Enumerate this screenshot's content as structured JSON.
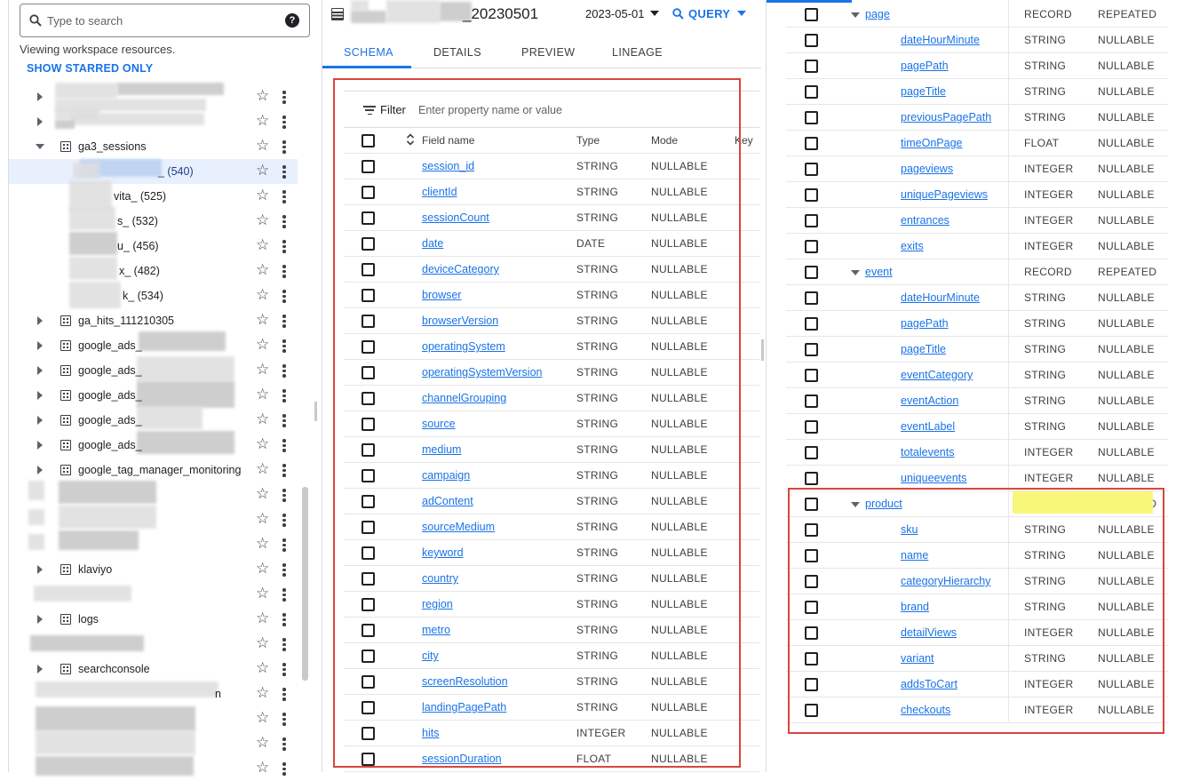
{
  "explorer": {
    "search": {
      "placeholder": "Type to search",
      "help_icon": "?"
    },
    "viewing_text": "Viewing workspace resources.",
    "show_starred_label": "SHOW STARRED ONLY",
    "items": [
      {
        "label": "ga3_sessions"
      },
      {
        "label": "_ (540)"
      },
      {
        "label": "vita_ (525)"
      },
      {
        "label": "s_ (532)"
      },
      {
        "label": "u_ (456)"
      },
      {
        "label": "x_ (482)"
      },
      {
        "label": "k_ (534)"
      },
      {
        "label": "ga_hits_111210305"
      },
      {
        "label": "google_ads_"
      },
      {
        "label": "google_ads_"
      },
      {
        "label": "google_ads_"
      },
      {
        "label": "google_ads_"
      },
      {
        "label": "google_ads_"
      },
      {
        "label": "google_tag_manager_monitoring"
      },
      {
        "label": "klaviyo"
      },
      {
        "label": "logs"
      },
      {
        "label": "searchconsole"
      },
      {
        "label": "n"
      }
    ]
  },
  "header": {
    "table_title": "_20230501",
    "date_value": "2023-05-01",
    "query_label": "QUERY"
  },
  "tabs": [
    "SCHEMA",
    "DETAILS",
    "PREVIEW",
    "LINEAGE"
  ],
  "filter": {
    "label": "Filter",
    "placeholder": "Enter property name or value"
  },
  "schema_header": {
    "field_name": "Field name",
    "type": "Type",
    "mode": "Mode",
    "key": "Key"
  },
  "schema_fields": [
    {
      "name": "session_id",
      "type": "STRING",
      "mode": "NULLABLE"
    },
    {
      "name": "clientId",
      "type": "STRING",
      "mode": "NULLABLE"
    },
    {
      "name": "sessionCount",
      "type": "STRING",
      "mode": "NULLABLE"
    },
    {
      "name": "date",
      "type": "DATE",
      "mode": "NULLABLE"
    },
    {
      "name": "deviceCategory",
      "type": "STRING",
      "mode": "NULLABLE"
    },
    {
      "name": "browser",
      "type": "STRING",
      "mode": "NULLABLE"
    },
    {
      "name": "browserVersion",
      "type": "STRING",
      "mode": "NULLABLE"
    },
    {
      "name": "operatingSystem",
      "type": "STRING",
      "mode": "NULLABLE"
    },
    {
      "name": "operatingSystemVersion",
      "type": "STRING",
      "mode": "NULLABLE"
    },
    {
      "name": "channelGrouping",
      "type": "STRING",
      "mode": "NULLABLE"
    },
    {
      "name": "source",
      "type": "STRING",
      "mode": "NULLABLE"
    },
    {
      "name": "medium",
      "type": "STRING",
      "mode": "NULLABLE"
    },
    {
      "name": "campaign",
      "type": "STRING",
      "mode": "NULLABLE"
    },
    {
      "name": "adContent",
      "type": "STRING",
      "mode": "NULLABLE"
    },
    {
      "name": "sourceMedium",
      "type": "STRING",
      "mode": "NULLABLE"
    },
    {
      "name": "keyword",
      "type": "STRING",
      "mode": "NULLABLE"
    },
    {
      "name": "country",
      "type": "STRING",
      "mode": "NULLABLE"
    },
    {
      "name": "region",
      "type": "STRING",
      "mode": "NULLABLE"
    },
    {
      "name": "metro",
      "type": "STRING",
      "mode": "NULLABLE"
    },
    {
      "name": "city",
      "type": "STRING",
      "mode": "NULLABLE"
    },
    {
      "name": "screenResolution",
      "type": "STRING",
      "mode": "NULLABLE"
    },
    {
      "name": "landingPagePath",
      "type": "STRING",
      "mode": "NULLABLE"
    },
    {
      "name": "hits",
      "type": "INTEGER",
      "mode": "NULLABLE"
    },
    {
      "name": "sessionDuration",
      "type": "FLOAT",
      "mode": "NULLABLE"
    }
  ],
  "nested_fields": [
    {
      "name": "page",
      "type": "RECORD",
      "mode": "REPEATED",
      "record": true
    },
    {
      "name": "dateHourMinute",
      "type": "STRING",
      "mode": "NULLABLE"
    },
    {
      "name": "pagePath",
      "type": "STRING",
      "mode": "NULLABLE"
    },
    {
      "name": "pageTitle",
      "type": "STRING",
      "mode": "NULLABLE"
    },
    {
      "name": "previousPagePath",
      "type": "STRING",
      "mode": "NULLABLE"
    },
    {
      "name": "timeOnPage",
      "type": "FLOAT",
      "mode": "NULLABLE"
    },
    {
      "name": "pageviews",
      "type": "INTEGER",
      "mode": "NULLABLE"
    },
    {
      "name": "uniquePageviews",
      "type": "INTEGER",
      "mode": "NULLABLE"
    },
    {
      "name": "entrances",
      "type": "INTEGER",
      "mode": "NULLABLE"
    },
    {
      "name": "exits",
      "type": "INTEGER",
      "mode": "NULLABLE"
    },
    {
      "name": "event",
      "type": "RECORD",
      "mode": "REPEATED",
      "record": true
    },
    {
      "name": "dateHourMinute",
      "type": "STRING",
      "mode": "NULLABLE"
    },
    {
      "name": "pagePath",
      "type": "STRING",
      "mode": "NULLABLE"
    },
    {
      "name": "pageTitle",
      "type": "STRING",
      "mode": "NULLABLE"
    },
    {
      "name": "eventCategory",
      "type": "STRING",
      "mode": "NULLABLE"
    },
    {
      "name": "eventAction",
      "type": "STRING",
      "mode": "NULLABLE"
    },
    {
      "name": "eventLabel",
      "type": "STRING",
      "mode": "NULLABLE"
    },
    {
      "name": "totalevents",
      "type": "INTEGER",
      "mode": "NULLABLE"
    },
    {
      "name": "uniqueevents",
      "type": "INTEGER",
      "mode": "NULLABLE"
    },
    {
      "name": "product",
      "type": "RECORD",
      "mode": "REPEATED",
      "record": true,
      "highlighted": true
    },
    {
      "name": "sku",
      "type": "STRING",
      "mode": "NULLABLE"
    },
    {
      "name": "name",
      "type": "STRING",
      "mode": "NULLABLE"
    },
    {
      "name": "categoryHierarchy",
      "type": "STRING",
      "mode": "NULLABLE"
    },
    {
      "name": "brand",
      "type": "STRING",
      "mode": "NULLABLE"
    },
    {
      "name": "detailViews",
      "type": "INTEGER",
      "mode": "NULLABLE"
    },
    {
      "name": "variant",
      "type": "STRING",
      "mode": "NULLABLE"
    },
    {
      "name": "addsToCart",
      "type": "INTEGER",
      "mode": "NULLABLE"
    },
    {
      "name": "checkouts",
      "type": "INTEGER",
      "mode": "NULLABLE"
    }
  ],
  "colors": {
    "accent": "#1a73e8",
    "annotation_red": "#d9453d",
    "highlight_yellow": "#f8f77a",
    "selected_row": "#e8f0fe"
  }
}
